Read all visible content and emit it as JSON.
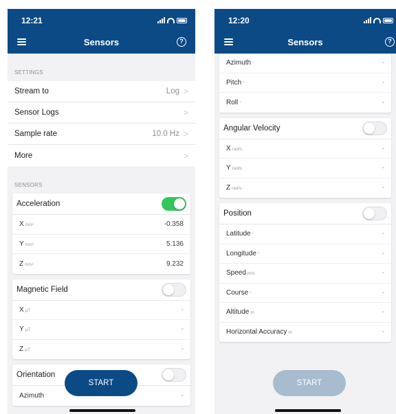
{
  "left": {
    "status_time": "12:21",
    "title": "Sensors",
    "settings_label": "SETTINGS",
    "settings": [
      {
        "label": "Stream to",
        "value": "Log"
      },
      {
        "label": "Sensor Logs",
        "value": ""
      },
      {
        "label": "Sample rate",
        "value": "10.0 Hz"
      },
      {
        "label": "More",
        "value": ""
      }
    ],
    "sensors_label": "SENSORS",
    "acceleration": {
      "title": "Acceleration",
      "enabled": true,
      "rows": [
        {
          "axis": "X",
          "unit": "m/s²",
          "value": "-0.358"
        },
        {
          "axis": "Y",
          "unit": "m/s²",
          "value": "5.136"
        },
        {
          "axis": "Z",
          "unit": "m/s²",
          "value": "9.232"
        }
      ]
    },
    "magnetic": {
      "title": "Magnetic Field",
      "enabled": false,
      "rows": [
        {
          "axis": "X",
          "unit": "µT",
          "value": "-"
        },
        {
          "axis": "Y",
          "unit": "µT",
          "value": "-"
        },
        {
          "axis": "Z",
          "unit": "µT",
          "value": "-"
        }
      ]
    },
    "orientation": {
      "title": "Orientation",
      "enabled": false,
      "rows": [
        {
          "axis": "Azimuth",
          "unit": "°",
          "value": "-"
        }
      ]
    },
    "start_label": "START"
  },
  "right": {
    "status_time": "12:20",
    "title": "Sensors",
    "orientation_rows": [
      {
        "axis": "Azimuth",
        "unit": "°",
        "value": "-"
      },
      {
        "axis": "Pitch",
        "unit": "°",
        "value": "-"
      },
      {
        "axis": "Roll",
        "unit": "°",
        "value": "-"
      }
    ],
    "angular": {
      "title": "Angular Velocity",
      "enabled": false,
      "rows": [
        {
          "axis": "X",
          "unit": "rad/s",
          "value": "-"
        },
        {
          "axis": "Y",
          "unit": "rad/s",
          "value": "-"
        },
        {
          "axis": "Z",
          "unit": "rad/s",
          "value": "-"
        }
      ]
    },
    "position": {
      "title": "Position",
      "enabled": false,
      "rows": [
        {
          "axis": "Latitude",
          "unit": "°",
          "value": "-"
        },
        {
          "axis": "Longitude",
          "unit": "°",
          "value": "-"
        },
        {
          "axis": "Speed",
          "unit": "m/s",
          "value": "-"
        },
        {
          "axis": "Course",
          "unit": "°",
          "value": "-"
        },
        {
          "axis": "Altitude",
          "unit": "m",
          "value": "-"
        },
        {
          "axis": "Horizontal Accuracy",
          "unit": "m",
          "value": "-"
        }
      ]
    },
    "start_label": "START"
  },
  "colors": {
    "header": "#0b4a85",
    "toggle_on": "#34c759",
    "start_active": "#0b4a85",
    "start_disabled": "#a7bccf"
  },
  "icons": [
    "menu-icon",
    "help-icon",
    "chevron-right-icon",
    "signal-icon",
    "wifi-icon",
    "battery-icon"
  ]
}
